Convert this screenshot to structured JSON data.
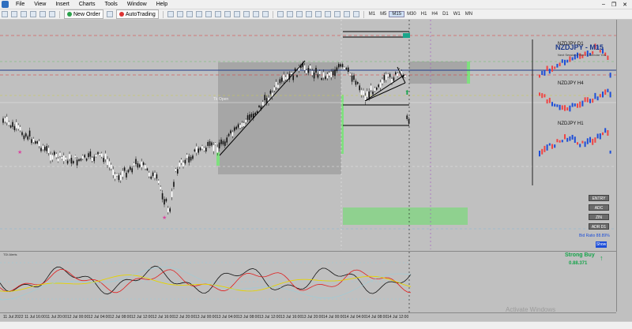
{
  "menu": {
    "items": [
      "File",
      "View",
      "Insert",
      "Charts",
      "Tools",
      "Window",
      "Help"
    ]
  },
  "toolbar": {
    "new_order": "New Order",
    "autotrading": "AutoTrading",
    "timeframes": [
      "M1",
      "M5",
      "M15",
      "M30",
      "H1",
      "H4",
      "D1",
      "W1",
      "MN"
    ],
    "active_tf": "M15"
  },
  "chart": {
    "symbol_title": "NZDJPY - M15",
    "subtitle": "Next Session Filter / Calendar Yes",
    "mini_charts": [
      "NZDJPY D1",
      "NZDJPY H4",
      "NZDJPY H1"
    ],
    "tk_open_label": "Tk Open",
    "side_buttons": [
      "ENTRY",
      "ADC",
      "ZIN",
      "ADR D1"
    ],
    "bid_ratio": "Bid Ratio 88.89%",
    "show_button": "Show",
    "signal": "Strong Buy",
    "signal_value": "0.88.371",
    "up_arrow": "↑",
    "colors": {
      "background": "#c0c0c0",
      "bull_candle": "#1d4ed8",
      "bear_candle": "#ef4444",
      "buy": "#16a34a",
      "zone": "#a6a6a6",
      "green_zone": "#8fd18f",
      "trendline": "#000000",
      "mid_line": "#1e3a8a"
    }
  },
  "indicator": {
    "label": "TDI Alerts"
  },
  "time_axis": {
    "labels": [
      "11 Jul 2022",
      "11 Jul 16:00",
      "11 Jul 20:00",
      "12 Jul 00:00",
      "12 Jul 04:00",
      "12 Jul 08:00",
      "12 Jul 12:00",
      "12 Jul 16:00",
      "12 Jul 20:00",
      "13 Jul 00:00",
      "13 Jul 04:00",
      "13 Jul 08:00",
      "13 Jul 12:00",
      "13 Jul 16:00",
      "13 Jul 20:00",
      "14 Jul 00:00",
      "14 Jul 04:00",
      "14 Jul 08:00",
      "14 Jul 12:00"
    ]
  },
  "watermark": "Activate Windows"
}
